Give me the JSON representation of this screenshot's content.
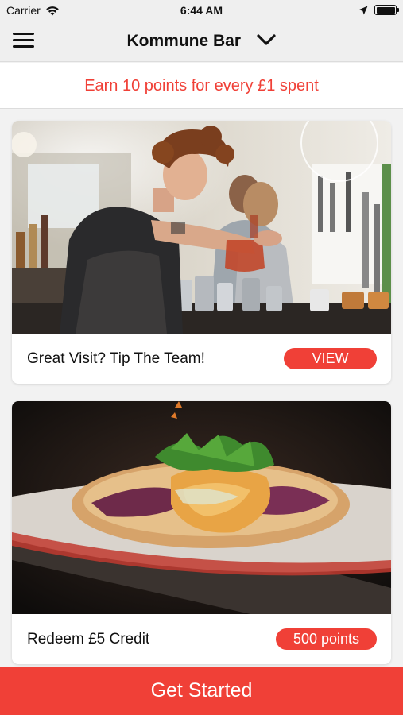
{
  "status_bar": {
    "carrier": "Carrier",
    "time": "6:44 AM",
    "icons": [
      "wifi-icon",
      "location-arrow-icon",
      "battery-icon"
    ]
  },
  "nav": {
    "title": "Kommune Bar",
    "icons": [
      "menu-icon",
      "chevron-down-icon"
    ]
  },
  "promo": {
    "text": "Earn 10 points for every £1 spent"
  },
  "cards": [
    {
      "title": "Great Visit? Tip The Team!",
      "action_label": "VIEW",
      "image": "bartender pouring a drink"
    },
    {
      "title": "Redeem £5 Credit",
      "action_label": "500 points",
      "image": "flatbread dish with greens"
    }
  ],
  "cta": {
    "label": "Get Started"
  },
  "colors": {
    "accent": "#f04037",
    "background": "#f2f2f2",
    "bar": "#efefef"
  }
}
